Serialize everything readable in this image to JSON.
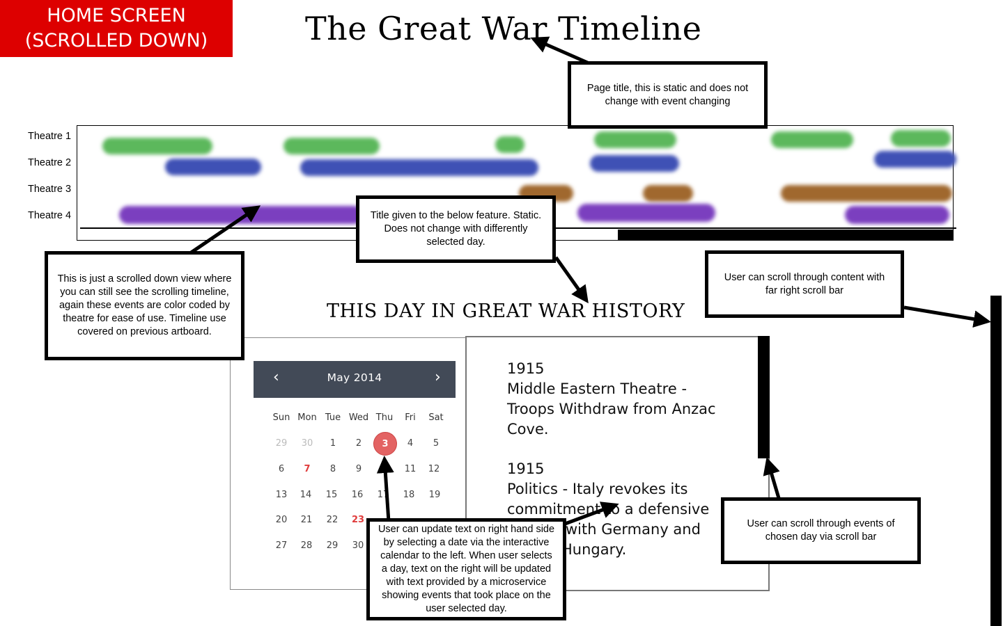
{
  "badge": {
    "line1": "HOME SCREEN",
    "line2": "(SCROLLED DOWN)"
  },
  "page_title": "The Great War Timeline",
  "annotations": {
    "title_note": "Page title, this is static and does not change with event changing",
    "timeline_note": "This is just a scrolled down view where you can still see the scrolling timeline, again these events are color coded by theatre for ease of use. Timeline use covered on previous artboard.",
    "feature_note": "Title given to the below feature. Static. Does not change with differently selected day.",
    "page_scroll_note": "User can scroll through content with far right scroll bar",
    "calendar_note": "User can update text on right hand side by selecting a date via the interactive calendar to the left. When user selects a day, text on the right will be updated with text provided by a microservice showing events that took place on the user selected day.",
    "events_scroll_note": "User can scroll through events of chosen day via scroll bar"
  },
  "timeline": {
    "theatres": [
      "Theatre 1",
      "Theatre 2",
      "Theatre 3",
      "Theatre 4"
    ],
    "colors": {
      "theatre_1": "#5cb85c",
      "theatre_2": "#3f51b5",
      "theatre_3": "#a0682e",
      "theatre_4": "#7b3fbf"
    }
  },
  "feature_title": "THIS DAY IN GREAT WAR HISTORY",
  "calendar": {
    "month_label": "May 2014",
    "prev_icon": "‹",
    "next_icon": "›",
    "weekdays": [
      "Sun",
      "Mon",
      "Tue",
      "Wed",
      "Thu",
      "Fri",
      "Sat"
    ],
    "weeks": [
      [
        "29",
        "30",
        "1",
        "2",
        "3",
        "4",
        "5"
      ],
      [
        "6",
        "7",
        "8",
        "9",
        "",
        "11",
        "12"
      ],
      [
        "13",
        "14",
        "15",
        "16",
        "17",
        "18",
        "19"
      ],
      [
        "20",
        "21",
        "22",
        "23",
        "",
        "",
        ""
      ],
      [
        "27",
        "28",
        "29",
        "30",
        "",
        "",
        ""
      ]
    ],
    "selected_day": "3",
    "header_color": "#424a57",
    "selected_color": "#e36363"
  },
  "events": [
    {
      "year": "1915",
      "lines": [
        "Middle Eastern Theatre -",
        "Troops Withdraw from Anzac",
        "Cove."
      ]
    },
    {
      "year": "1915",
      "lines": [
        "Politics - Italy revokes its",
        "commitment to a defensive",
        "with Germany and",
        "Hungary."
      ]
    }
  ]
}
